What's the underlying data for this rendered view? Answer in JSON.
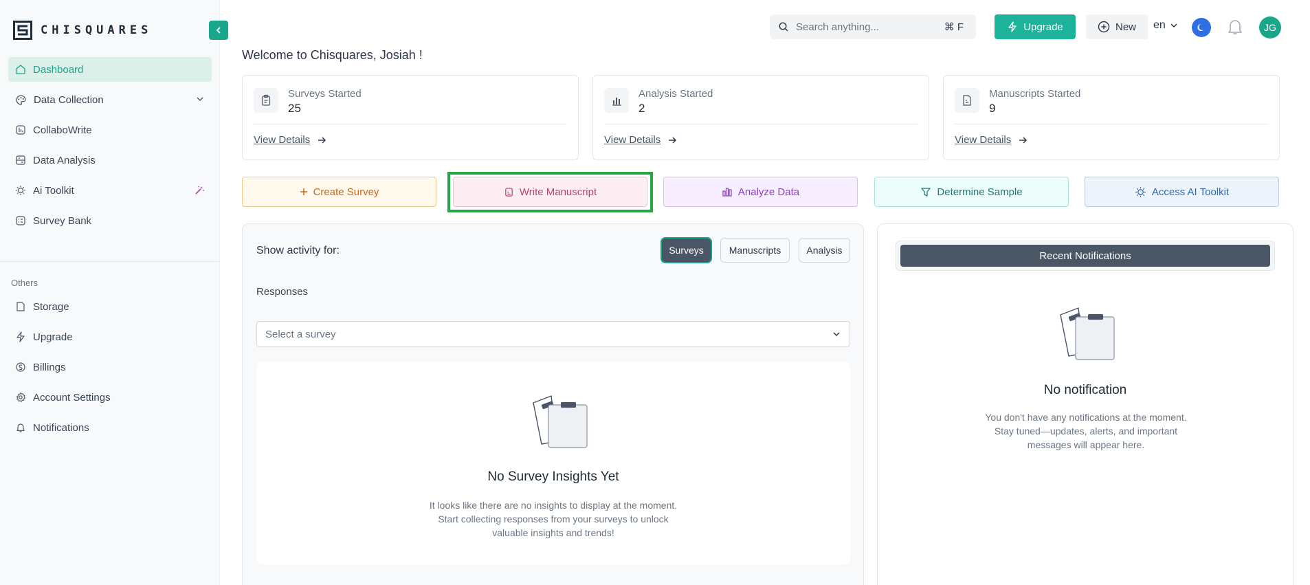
{
  "brand": {
    "name": "CHISQUARES"
  },
  "sidebar": {
    "items": [
      {
        "label": "Dashboard"
      },
      {
        "label": "Data Collection"
      },
      {
        "label": "CollaboWrite"
      },
      {
        "label": "Data Analysis"
      },
      {
        "label": "Ai Toolkit"
      },
      {
        "label": "Survey Bank"
      }
    ],
    "others_label": "Others",
    "others": [
      {
        "label": "Storage"
      },
      {
        "label": "Upgrade"
      },
      {
        "label": "Billings"
      },
      {
        "label": "Account Settings"
      },
      {
        "label": "Notifications"
      }
    ]
  },
  "topbar": {
    "search_placeholder": "Search anything...",
    "shortcut": "⌘ F",
    "upgrade_label": "Upgrade",
    "new_label": "New",
    "language": "en",
    "avatar_initials": "JG"
  },
  "welcome": "Welcome to Chisquares, Josiah !",
  "stats": [
    {
      "label": "Surveys Started",
      "value": "25",
      "link": "View Details"
    },
    {
      "label": "Analysis Started",
      "value": "2",
      "link": "View Details"
    },
    {
      "label": "Manuscripts Started",
      "value": "9",
      "link": "View Details"
    }
  ],
  "actions": {
    "create_survey": "Create Survey",
    "write_manuscript": "Write Manuscript",
    "analyze_data": "Analyze Data",
    "determine_sample": "Determine Sample",
    "access_ai_toolkit": "Access AI Toolkit"
  },
  "activity": {
    "show_label": "Show activity for:",
    "tabs": [
      {
        "label": "Surveys",
        "active": true
      },
      {
        "label": "Manuscripts",
        "active": false
      },
      {
        "label": "Analysis",
        "active": false
      }
    ],
    "responses_label": "Responses",
    "select_placeholder": "Select a survey",
    "empty_title": "No Survey Insights Yet",
    "empty_desc": "It looks like there are no insights to display at the moment. Start collecting responses from your surveys to unlock valuable insights and trends!"
  },
  "notifications": {
    "header": "Recent Notifications",
    "empty_title": "No notification",
    "empty_desc": "You don't have any notifications at the moment. Stay tuned—updates, alerts, and important messages will appear here."
  },
  "colors": {
    "accent": "#1aa68a",
    "highlight": "#22a845"
  }
}
